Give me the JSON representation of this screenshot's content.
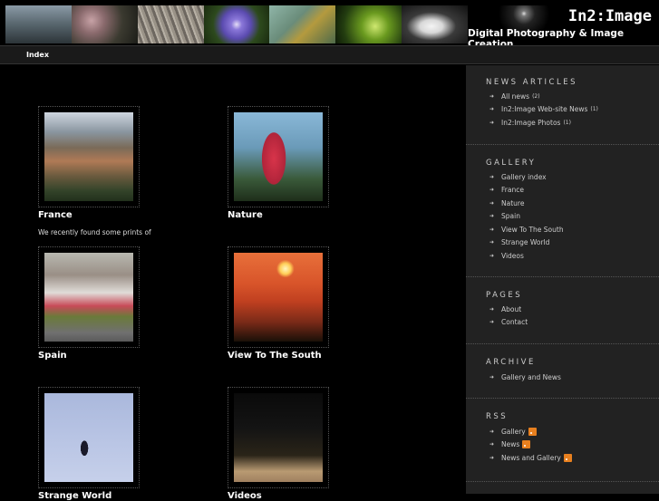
{
  "header": {
    "site_title": "In2:Image",
    "tagline": "Digital Photography & Image Creation",
    "banner_thumbs": [
      "coast",
      "mushrooms",
      "cat",
      "blue-flower",
      "lizard",
      "green-plant",
      "arch"
    ]
  },
  "nav": {
    "index_label": "Index"
  },
  "gallery": [
    {
      "title": "France",
      "excerpt": "We recently found some prints of",
      "photo": "france"
    },
    {
      "title": "Nature",
      "excerpt": "",
      "photo": "nature"
    },
    {
      "title": "Spain",
      "excerpt": "",
      "photo": "spain"
    },
    {
      "title": "View To The South",
      "excerpt": "",
      "photo": "sunset"
    },
    {
      "title": "Strange World",
      "excerpt": "",
      "photo": "strange"
    },
    {
      "title": "Videos",
      "excerpt": "",
      "photo": "videos"
    }
  ],
  "sidebar": {
    "news": {
      "heading": "NEWS ARTICLES",
      "items": [
        {
          "label": "All news",
          "count": "(2)"
        },
        {
          "label": "In2:Image Web-site News",
          "count": "(1)"
        },
        {
          "label": "In2:Image Photos",
          "count": "(1)"
        }
      ]
    },
    "gallery": {
      "heading": "GALLERY",
      "items": [
        {
          "label": "Gallery index"
        },
        {
          "label": "France"
        },
        {
          "label": "Nature"
        },
        {
          "label": "Spain"
        },
        {
          "label": "View To The South"
        },
        {
          "label": "Strange World"
        },
        {
          "label": "Videos"
        }
      ]
    },
    "pages": {
      "heading": "PAGES",
      "items": [
        {
          "label": "About"
        },
        {
          "label": "Contact"
        }
      ]
    },
    "archive": {
      "heading": "ARCHIVE",
      "items": [
        {
          "label": "Gallery and News"
        }
      ]
    },
    "rss": {
      "heading": "RSS",
      "items": [
        {
          "label": "Gallery"
        },
        {
          "label": "News"
        },
        {
          "label": "News and Gallery"
        }
      ]
    }
  },
  "colors": {
    "background": "#000000",
    "sidebar": "#222222",
    "navbar": "#1a1a1a",
    "rss": "#e8801f"
  }
}
